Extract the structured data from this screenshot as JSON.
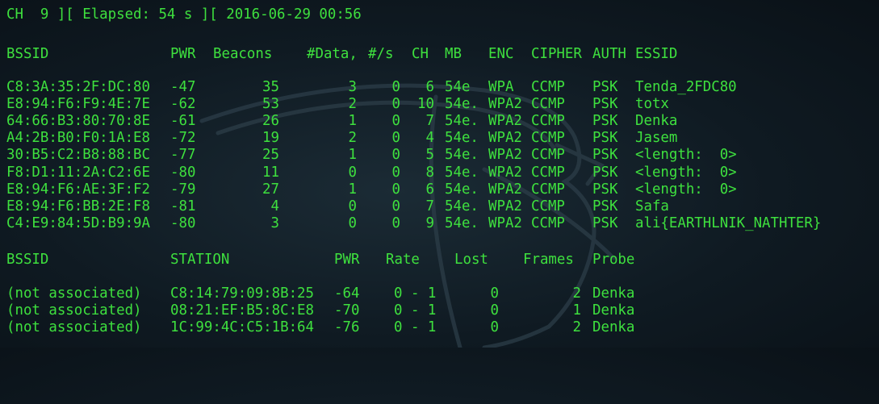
{
  "status_line": "CH  9 ][ Elapsed: 54 s ][ 2016-06-29 00:56",
  "ap_headers": {
    "bssid": "BSSID",
    "pwr": "PWR",
    "beacons": "Beacons",
    "data": "#Data,",
    "per_sec": "#/s",
    "ch": "CH",
    "mb": "MB",
    "enc": "ENC",
    "cipher": "CIPHER",
    "auth": "AUTH",
    "essid": "ESSID"
  },
  "access_points": [
    {
      "bssid": "C8:3A:35:2F:DC:80",
      "pwr": "-47",
      "beacons": "35",
      "data": "3",
      "per_sec": "0",
      "ch": "6",
      "mb": "54e",
      "enc": "WPA",
      "cipher": "CCMP",
      "auth": "PSK",
      "essid": "Tenda_2FDC80"
    },
    {
      "bssid": "E8:94:F6:F9:4E:7E",
      "pwr": "-62",
      "beacons": "53",
      "data": "2",
      "per_sec": "0",
      "ch": "10",
      "mb": "54e.",
      "enc": "WPA2",
      "cipher": "CCMP",
      "auth": "PSK",
      "essid": "totx"
    },
    {
      "bssid": "64:66:B3:80:70:8E",
      "pwr": "-61",
      "beacons": "26",
      "data": "1",
      "per_sec": "0",
      "ch": "7",
      "mb": "54e.",
      "enc": "WPA2",
      "cipher": "CCMP",
      "auth": "PSK",
      "essid": "Denka"
    },
    {
      "bssid": "A4:2B:B0:F0:1A:E8",
      "pwr": "-72",
      "beacons": "19",
      "data": "2",
      "per_sec": "0",
      "ch": "4",
      "mb": "54e.",
      "enc": "WPA2",
      "cipher": "CCMP",
      "auth": "PSK",
      "essid": "Jasem"
    },
    {
      "bssid": "30:B5:C2:B8:88:BC",
      "pwr": "-77",
      "beacons": "25",
      "data": "1",
      "per_sec": "0",
      "ch": "5",
      "mb": "54e.",
      "enc": "WPA2",
      "cipher": "CCMP",
      "auth": "PSK",
      "essid": "<length:  0>"
    },
    {
      "bssid": "F8:D1:11:2A:C2:6E",
      "pwr": "-80",
      "beacons": "11",
      "data": "0",
      "per_sec": "0",
      "ch": "8",
      "mb": "54e.",
      "enc": "WPA2",
      "cipher": "CCMP",
      "auth": "PSK",
      "essid": "<length:  0>"
    },
    {
      "bssid": "E8:94:F6:AE:3F:F2",
      "pwr": "-79",
      "beacons": "27",
      "data": "1",
      "per_sec": "0",
      "ch": "6",
      "mb": "54e.",
      "enc": "WPA2",
      "cipher": "CCMP",
      "auth": "PSK",
      "essid": "<length:  0>"
    },
    {
      "bssid": "E8:94:F6:BB:2E:F8",
      "pwr": "-81",
      "beacons": "4",
      "data": "0",
      "per_sec": "0",
      "ch": "7",
      "mb": "54e.",
      "enc": "WPA2",
      "cipher": "CCMP",
      "auth": "PSK",
      "essid": "Safa"
    },
    {
      "bssid": "C4:E9:84:5D:B9:9A",
      "pwr": "-80",
      "beacons": "3",
      "data": "0",
      "per_sec": "0",
      "ch": "9",
      "mb": "54e.",
      "enc": "WPA2",
      "cipher": "CCMP",
      "auth": "PSK",
      "essid": "ali{EARTHLNIK_NATHTER}"
    }
  ],
  "station_headers": {
    "bssid": "BSSID",
    "station": "STATION",
    "pwr": "PWR",
    "rate": "Rate",
    "lost": "Lost",
    "frames": "Frames",
    "probe": "Probe"
  },
  "stations": [
    {
      "bssid": "(not associated)",
      "station": "C8:14:79:09:8B:25",
      "pwr": "-64",
      "rate": "0 - 1",
      "lost": "0",
      "frames": "2",
      "probe": "Denka"
    },
    {
      "bssid": "(not associated)",
      "station": "08:21:EF:B5:8C:E8",
      "pwr": "-70",
      "rate": "0 - 1",
      "lost": "0",
      "frames": "1",
      "probe": "Denka"
    },
    {
      "bssid": "(not associated)",
      "station": "1C:99:4C:C5:1B:64",
      "pwr": "-76",
      "rate": "0 - 1",
      "lost": "0",
      "frames": "2",
      "probe": "Denka"
    }
  ],
  "colors": {
    "text": "#3ee03e",
    "background": "#0f1a22"
  },
  "watermark": "dragon-logo"
}
